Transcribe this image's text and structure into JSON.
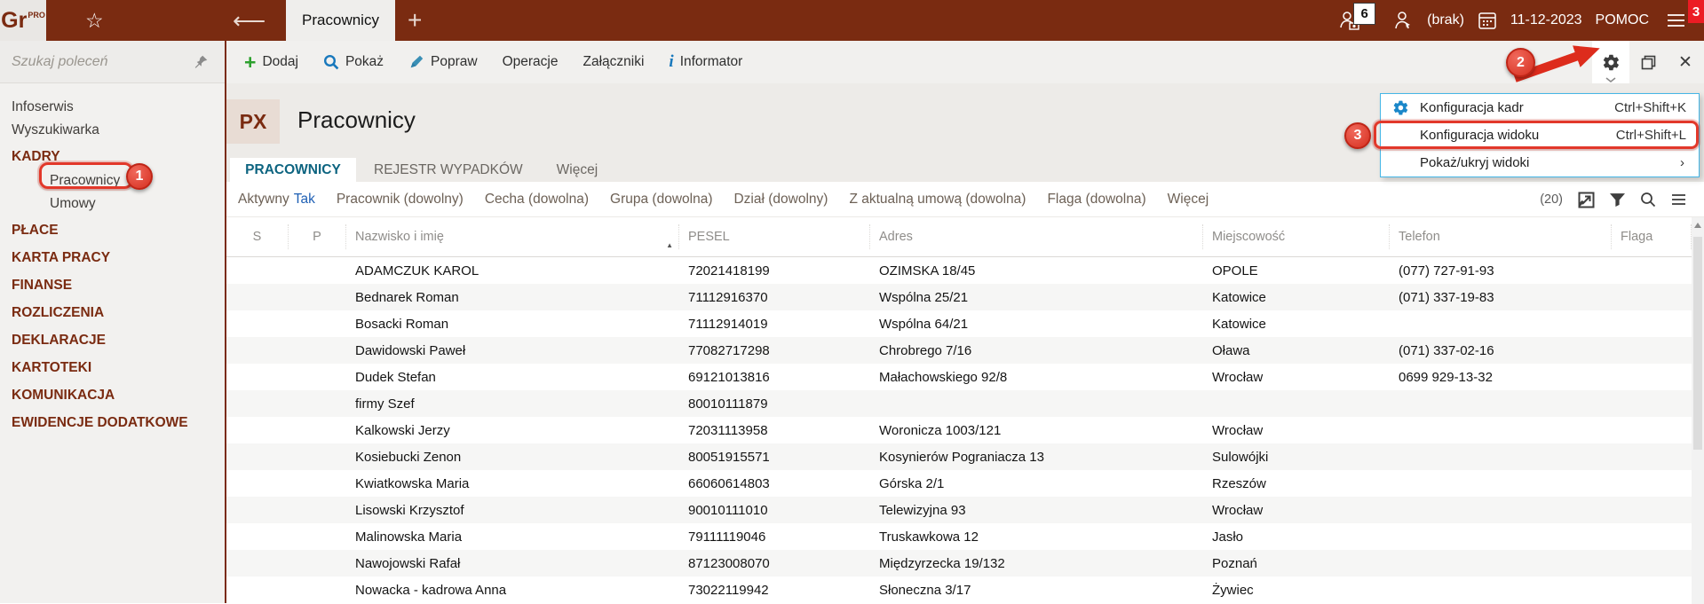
{
  "topbar": {
    "logo": "Gr",
    "logo_sup": "PRO",
    "tab_title": "Pracownicy",
    "user_badge": "6",
    "user_label": "(brak)",
    "date": "11-12-2023",
    "help_label": "POMOC",
    "menu_badge": "3"
  },
  "toolbar": {
    "items": [
      {
        "icon": "add-icon",
        "label": "Dodaj"
      },
      {
        "icon": "magnifier-icon",
        "label": "Pokaż"
      },
      {
        "icon": "pen-icon",
        "label": "Popraw"
      },
      {
        "icon": "",
        "label": "Operacje"
      },
      {
        "icon": "",
        "label": "Załączniki"
      },
      {
        "icon": "info-icon",
        "label": "Informator"
      }
    ]
  },
  "sidebar": {
    "search_placeholder": "Szukaj poleceń",
    "items": [
      {
        "label": "Infoserwis",
        "type": "link"
      },
      {
        "label": "Wyszukiwarka",
        "type": "link"
      },
      {
        "label": "KADRY",
        "type": "category"
      },
      {
        "label": "Pracownicy",
        "type": "sublink"
      },
      {
        "label": "Umowy",
        "type": "sublink"
      },
      {
        "label": "PŁACE",
        "type": "category"
      },
      {
        "label": "KARTA PRACY",
        "type": "category"
      },
      {
        "label": "FINANSE",
        "type": "category"
      },
      {
        "label": "ROZLICZENIA",
        "type": "category"
      },
      {
        "label": "DEKLARACJE",
        "type": "category"
      },
      {
        "label": "KARTOTEKI",
        "type": "category"
      },
      {
        "label": "KOMUNIKACJA",
        "type": "category"
      },
      {
        "label": "EWIDENCJE DODATKOWE",
        "type": "category"
      }
    ]
  },
  "page": {
    "module_code": "PX",
    "title": "Pracownicy"
  },
  "tabs": [
    {
      "label": "PRACOWNICY",
      "active": true
    },
    {
      "label": "REJESTR WYPADKÓW",
      "active": false
    },
    {
      "label": "Więcej",
      "active": false
    }
  ],
  "filters": {
    "items": [
      {
        "label": "Aktywny",
        "value": "Tak"
      },
      {
        "label": "Pracownik (dowolny)",
        "value": ""
      },
      {
        "label": "Cecha (dowolna)",
        "value": ""
      },
      {
        "label": "Grupa (dowolna)",
        "value": ""
      },
      {
        "label": "Dział (dowolny)",
        "value": ""
      },
      {
        "label": "Z aktualną umową (dowolna)",
        "value": ""
      },
      {
        "label": "Flaga (dowolna)",
        "value": ""
      },
      {
        "label": "Więcej",
        "value": ""
      }
    ],
    "count": "(20)"
  },
  "table": {
    "columns": [
      "S",
      "P",
      "Nazwisko i imię",
      "PESEL",
      "Adres",
      "Miejscowość",
      "Telefon",
      "Flaga"
    ],
    "sorted_column": "Nazwisko i imię",
    "rows": [
      [
        "",
        "",
        "ADAMCZUK KAROL",
        "72021418199",
        "OZIMSKA 18/45",
        "OPOLE",
        "(077) 727-91-93",
        ""
      ],
      [
        "",
        "",
        "Bednarek Roman",
        "71112916370",
        "Wspólna 25/21",
        "Katowice",
        "(071) 337-19-83",
        ""
      ],
      [
        "",
        "",
        "Bosacki Roman",
        "71112914019",
        "Wspólna 64/21",
        "Katowice",
        "",
        ""
      ],
      [
        "",
        "",
        "Dawidowski Paweł",
        "77082717298",
        "Chrobrego 7/16",
        "Oława",
        "(071) 337-02-16",
        ""
      ],
      [
        "",
        "",
        "Dudek Stefan",
        "69121013816",
        "Małachowskiego 92/8",
        "Wrocław",
        "0699 929-13-32",
        ""
      ],
      [
        "",
        "",
        "firmy Szef",
        "80010111879",
        "",
        "",
        "",
        ""
      ],
      [
        "",
        "",
        "Kalkowski Jerzy",
        "72031113958",
        "Woronicza 1003/121",
        "Wrocław",
        "",
        ""
      ],
      [
        "",
        "",
        "Kosiebucki Zenon",
        "80051915571",
        "Kosynierów Pograniacza 13",
        "Sulowójki",
        "",
        ""
      ],
      [
        "",
        "",
        "Kwiatkowska Maria",
        "66060614803",
        "Górska 2/1",
        "Rzeszów",
        "",
        ""
      ],
      [
        "",
        "",
        "Lisowski Krzysztof",
        "90010111010",
        "Telewizyjna 93",
        "Wrocław",
        "",
        ""
      ],
      [
        "",
        "",
        "Malinowska Maria",
        "79111119046",
        "Truskawkowa 12",
        "Jasło",
        "",
        ""
      ],
      [
        "",
        "",
        "Nawojowski Rafał",
        "87123008070",
        "Międzyrzecka 19/132",
        "Poznań",
        "",
        ""
      ],
      [
        "",
        "",
        "Nowacka - kadrowa Anna",
        "73022119942",
        "Słoneczna 3/17",
        "Żywiec",
        "",
        ""
      ]
    ]
  },
  "menu": {
    "items": [
      {
        "icon": "gear-icon",
        "label": "Konfiguracja kadr",
        "shortcut": "Ctrl+Shift+K",
        "submenu": false
      },
      {
        "icon": "",
        "label": "Konfiguracja widoku",
        "shortcut": "Ctrl+Shift+L",
        "submenu": false
      },
      {
        "icon": "",
        "label": "Pokaż/ukryj widoki",
        "shortcut": "",
        "submenu": true
      }
    ]
  },
  "annotations": {
    "step1": "1",
    "step2": "2",
    "step3": "3"
  },
  "colors": {
    "brand": "#7a2b11",
    "active_tab": "#0d6480",
    "filter_value": "#2061b5",
    "annotation_red": "#e2382a",
    "menu_border": "#45b6e6"
  }
}
